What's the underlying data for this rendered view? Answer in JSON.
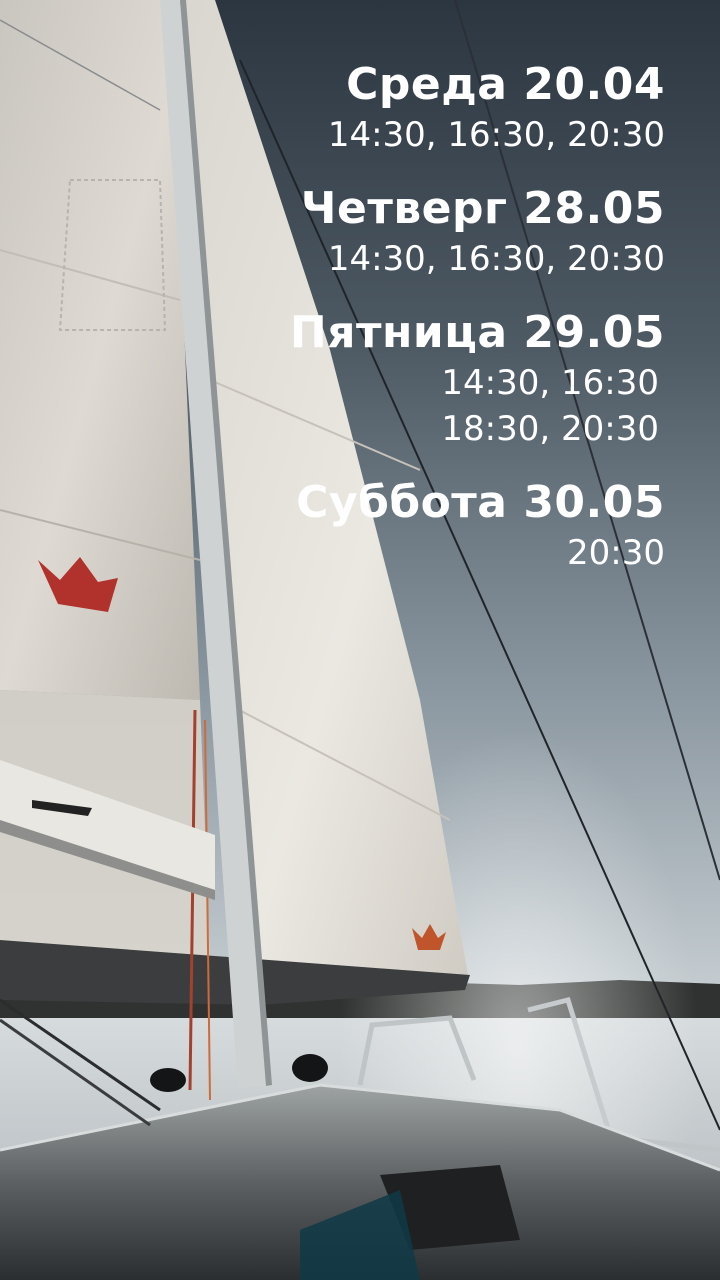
{
  "schedule": [
    {
      "day": "Среда 20.04",
      "times": [
        "14:30, 16:30, 20:30"
      ]
    },
    {
      "day": "Четверг 28.05",
      "times": [
        "14:30, 16:30, 20:30"
      ]
    },
    {
      "day": "Пятница 29.05",
      "times": [
        "14:30, 16:30",
        "18:30, 20:30"
      ]
    },
    {
      "day": "Суббота 30.05",
      "times": [
        "20:30"
      ]
    }
  ],
  "colors": {
    "sky_top": "#2f3942",
    "sky_bottom": "#b7c1c7",
    "sail": "#e6e3dc",
    "water": "#c9cfd2",
    "text": "#ffffff",
    "logo": "#b1322c"
  }
}
